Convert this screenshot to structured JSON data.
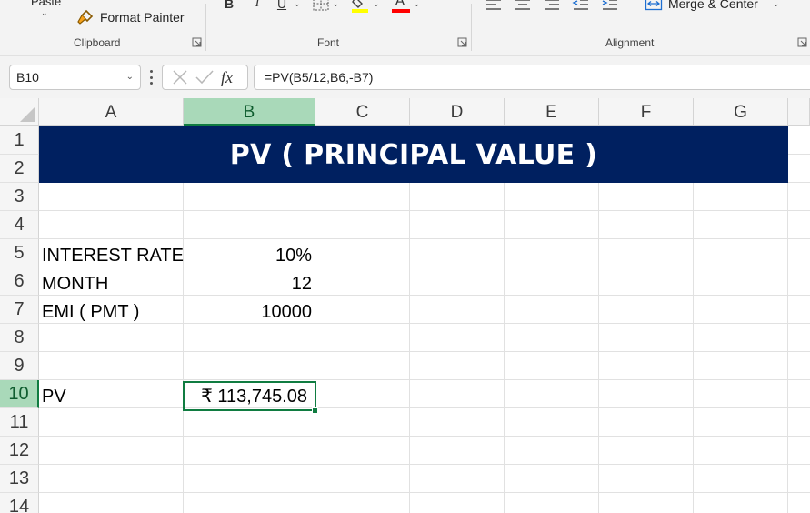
{
  "ribbon": {
    "paste_label": "Paste",
    "format_painter_label": "Format Painter",
    "clipboard_group": "Clipboard",
    "font_group": "Font",
    "alignment_group": "Alignment",
    "bold": "B",
    "italic": "I",
    "underline": "U",
    "font_color_letter": "A",
    "merge_center_label": "Merge & Center",
    "highlight_color": "#ffff00",
    "font_color": "#ff0000"
  },
  "formula_bar": {
    "name_box": "B10",
    "fx_label": "fx",
    "formula": "=PV(B5/12,B6,-B7)"
  },
  "sheet": {
    "columns": [
      "A",
      "B",
      "C",
      "D",
      "E",
      "F",
      "G"
    ],
    "rows": [
      "1",
      "2",
      "3",
      "4",
      "5",
      "6",
      "7",
      "8",
      "9",
      "10",
      "11",
      "12",
      "13",
      "14"
    ],
    "selected_column": "B",
    "selected_row": "10",
    "title": "PV ( PRINCIPAL VALUE )",
    "title_fill": "#002060",
    "cells": {
      "A5": "INTEREST RATE",
      "B5": "10%",
      "A6": "MONTH",
      "B6": "12",
      "A7": "EMI ( PMT )",
      "B7": "10000",
      "A10": "PV",
      "B10": "₹ 113,745.08"
    }
  }
}
